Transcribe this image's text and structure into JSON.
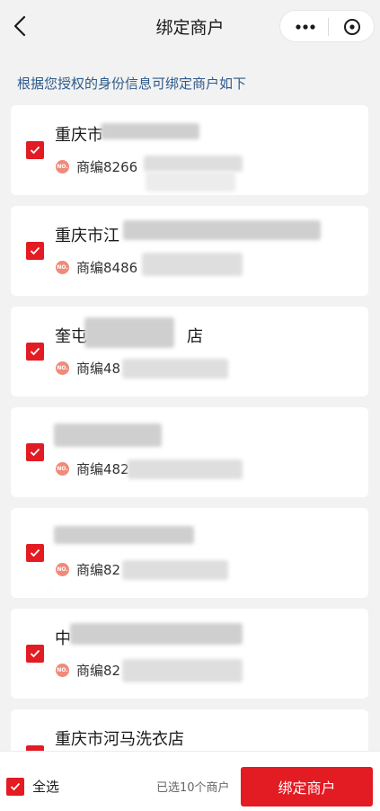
{
  "header": {
    "title": "绑定商户",
    "back_icon": "chevron-left-icon",
    "more_icon": "more-dots-icon",
    "close_icon": "circle-close-icon"
  },
  "hint": "根据您授权的身份信息可绑定商户如下",
  "merchants": [
    {
      "name": "重庆市",
      "code": "商编8266",
      "checked": true
    },
    {
      "name": "重庆市江",
      "code": "商编8486",
      "checked": true
    },
    {
      "name": "奎屯",
      "name_tail": "店",
      "code": "商编48",
      "checked": true
    },
    {
      "name": "",
      "code": "商编482",
      "checked": true
    },
    {
      "name": "",
      "code": "商编82",
      "checked": true
    },
    {
      "name": "中",
      "code": "商编82",
      "checked": true
    },
    {
      "name": "重庆市河马洗衣店",
      "code": "",
      "checked": true
    }
  ],
  "no_badge": "NO.",
  "footer": {
    "select_all": "全选",
    "selected_text": "已选10个商户",
    "bind_button": "绑定商户"
  },
  "colors": {
    "accent": "#e31b23",
    "hint_text": "#2d5a8a",
    "background": "#f2f2f2"
  }
}
